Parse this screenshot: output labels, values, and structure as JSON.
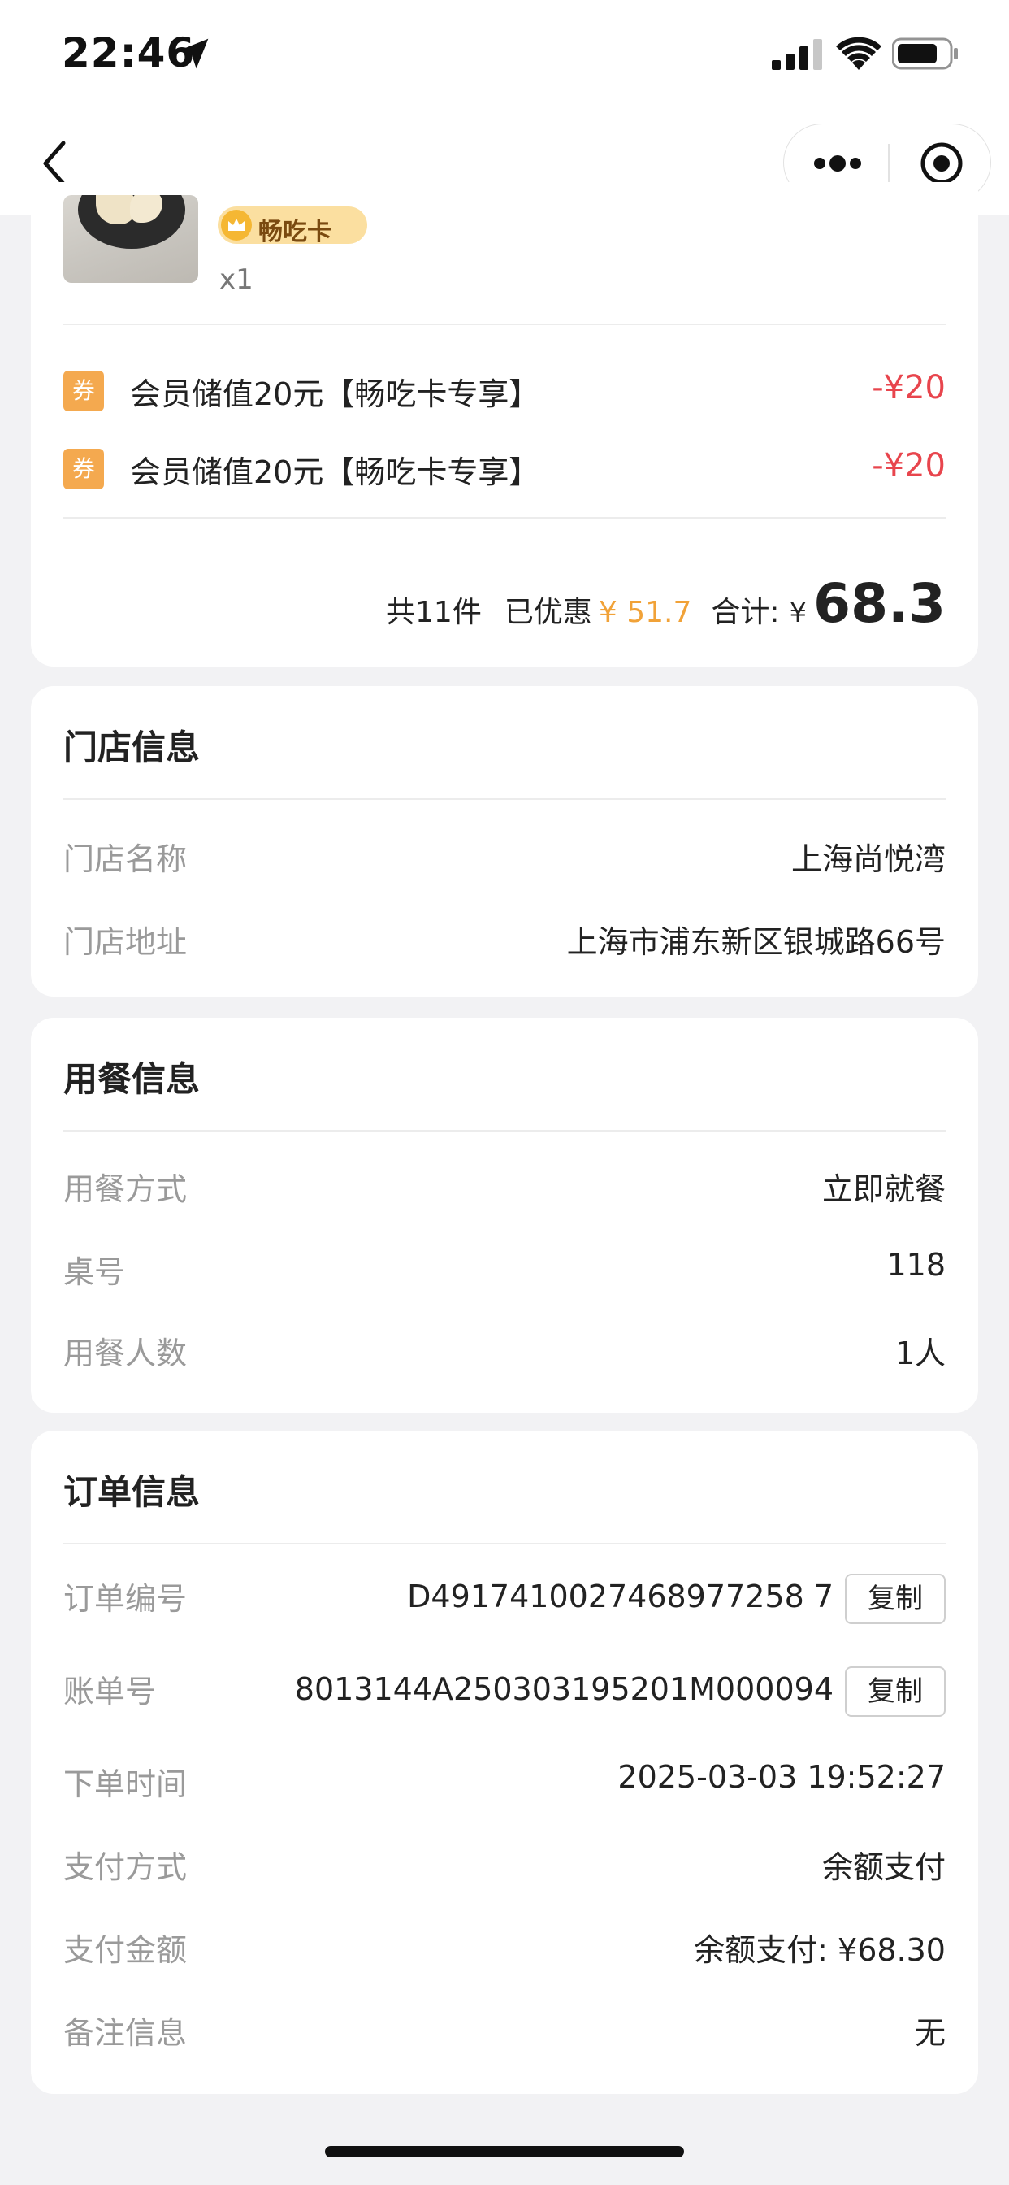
{
  "status_bar": {
    "time": "22:46"
  },
  "product": {
    "badge": "畅吃卡",
    "quantity": "x1"
  },
  "coupons": [
    {
      "tag": "券",
      "text": "会员储值20元【畅吃卡专享】",
      "amount": "-¥20"
    },
    {
      "tag": "券",
      "text": "会员储值20元【畅吃卡专享】",
      "amount": "-¥20"
    }
  ],
  "summary": {
    "count": "共11件",
    "discount_label": "已优惠",
    "discount_value": "¥ 51.7",
    "total_label": "合计:",
    "currency": "¥",
    "total": "68.3"
  },
  "store_info": {
    "title": "门店信息",
    "name_label": "门店名称",
    "name_value": "上海尚悦湾",
    "address_label": "门店地址",
    "address_value": "上海市浦东新区银城路66号"
  },
  "dining_info": {
    "title": "用餐信息",
    "mode_label": "用餐方式",
    "mode_value": "立即就餐",
    "table_label": "桌号",
    "table_value": "118",
    "people_label": "用餐人数",
    "people_value": "1人"
  },
  "order_info": {
    "title": "订单信息",
    "order_no_label": "订单编号",
    "order_no_value": "D4917410027468977258 7",
    "bill_no_label": "账单号",
    "bill_no_value": "8013144A250303195201M000094",
    "copy_label": "复制",
    "time_label": "下单时间",
    "time_value": "2025-03-03 19:52:27",
    "pay_method_label": "支付方式",
    "pay_method_value": "余额支付",
    "pay_amount_label": "支付金额",
    "pay_amount_value": "余额支付: ¥68.30",
    "remark_label": "备注信息",
    "remark_value": "无"
  },
  "colors": {
    "accent_red": "#e8454d",
    "accent_orange": "#f1a238",
    "coupon_tag": "#f4a94f"
  }
}
